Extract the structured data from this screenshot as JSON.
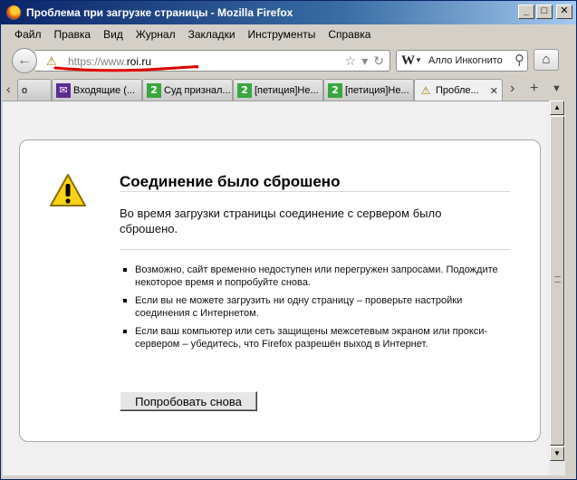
{
  "window": {
    "title": "Проблема при загрузке страницы - Mozilla Firefox",
    "buttons": {
      "minimize": "_",
      "maximize": "□",
      "close": "✕"
    }
  },
  "menu": [
    {
      "label": "Файл"
    },
    {
      "label": "Правка"
    },
    {
      "label": "Вид"
    },
    {
      "label": "Журнал"
    },
    {
      "label": "Закладки"
    },
    {
      "label": "Инструменты"
    },
    {
      "label": "Справка"
    }
  ],
  "navbar": {
    "back_icon": "back-arrow-icon",
    "url_prefix": "https://www.",
    "url_host": "roi.ru",
    "search_engine": "W",
    "search_text": "Алло Инкогнито",
    "annotation_color": "#e00000"
  },
  "tabs": [
    {
      "label": "o",
      "icon": "none"
    },
    {
      "label": "Входящие (...",
      "icon": "mail-icon"
    },
    {
      "label": "Суд признал...",
      "icon": "green-2-icon"
    },
    {
      "label": "[петиция]Не...",
      "icon": "green-2-icon"
    },
    {
      "label": "[петиция]Не...",
      "icon": "green-2-icon"
    },
    {
      "label": "Пробле...",
      "icon": "warning-icon",
      "active": true
    }
  ],
  "error": {
    "title": "Соединение было сброшено",
    "description": "Во время загрузки страницы соединение с сервером было сброшено.",
    "bullets": [
      "Возможно, сайт временно недоступен или перегружен запросами. Подождите некоторое время и попробуйте снова.",
      "Если вы не можете загрузить ни одну страницу – проверьте настройки соединения с Интернетом.",
      "Если ваш компьютер или сеть защищены межсетевым экраном или прокси-сервером – убедитесь, что Firefox разрешён выход в Интернет."
    ],
    "retry_label": "Попробовать снова"
  }
}
